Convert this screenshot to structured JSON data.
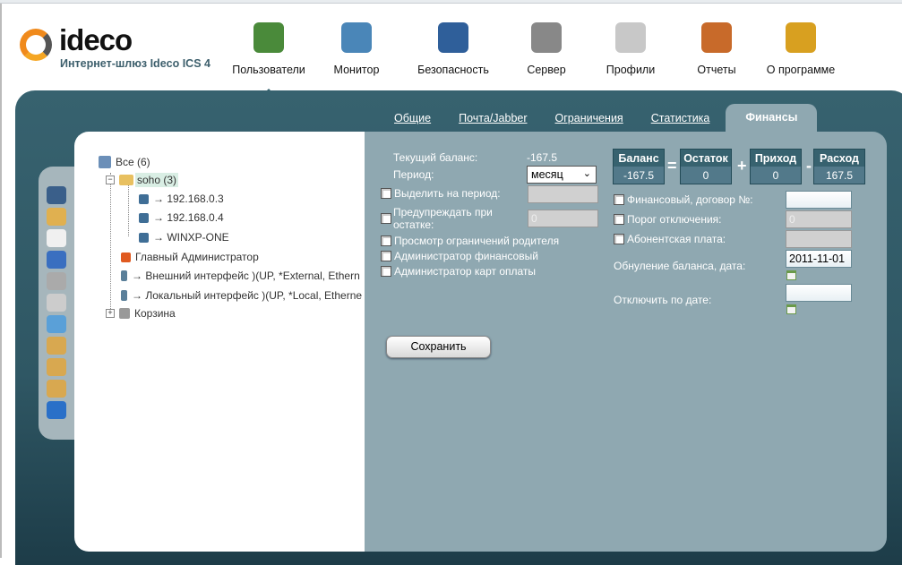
{
  "brand": {
    "name": "ideco",
    "subtitle": "Интернет-шлюз Ideco ICS 4"
  },
  "nav": [
    {
      "label": "Пользователи",
      "icon": "users-icon",
      "color": "#4a8a3a",
      "active": true
    },
    {
      "label": "Монитор",
      "icon": "monitor-icon",
      "color": "#4a86b8"
    },
    {
      "label": "Безопасность",
      "icon": "shield-icon",
      "color": "#2f5f9a"
    },
    {
      "label": "Сервер",
      "icon": "server-icon",
      "color": "#888888"
    },
    {
      "label": "Профили",
      "icon": "profile-icon",
      "color": "#c8c8c8"
    },
    {
      "label": "Отчеты",
      "icon": "report-icon",
      "color": "#c86a2a"
    },
    {
      "label": "О программе",
      "icon": "about-icon",
      "color": "#d8a020"
    }
  ],
  "tabs": [
    {
      "label": "Общие"
    },
    {
      "label": "Почта/Jabber"
    },
    {
      "label": "Ограничения"
    },
    {
      "label": "Статистика"
    },
    {
      "label": "Финансы",
      "active": true
    }
  ],
  "toolbar": [
    "add-user-icon",
    "add-folder-icon",
    "mail-icon",
    "info-icon",
    "server-icon",
    "search-icon",
    "monitor-icon",
    "clipboard-add-icon",
    "clipboard-list-icon",
    "clipboard-delete-icon",
    "refresh-icon"
  ],
  "tree": {
    "root": "Все (6)",
    "group": "soho (3)",
    "hosts": [
      "→ 192.168.0.3",
      "→ 192.168.0.4",
      "→ WINXP-ONE"
    ],
    "admin": "Главный Администратор",
    "ext": "→ Внешний интерфейс )(UP, *External, Ethern",
    "loc": "→ Локальный интерфейс )(UP, *Local, Etherne",
    "trash": "Корзина"
  },
  "form": {
    "balance_label": "Текущий баланс:",
    "balance_value": "-167.5",
    "period_label": "Период:",
    "period_value": "месяц",
    "allot_label": "Выделить на период:",
    "warn_label1": "Предупреждать при",
    "warn_label2": "остатке:",
    "warn_value": "0",
    "parent_label": "Просмотр ограничений родителя",
    "fin_admin_label": "Администратор финансовый",
    "card_admin_label": "Администратор карт оплаты",
    "contract_label": "Финансовый, договор №:",
    "threshold_label": "Порог отключения:",
    "threshold_value": "0",
    "fee_label": "Абонентская плата:",
    "reset_label": "Обнуление баланса, дата:",
    "reset_value": "2011-11-01",
    "disable_label": "Отключить по дате:",
    "save": "Сохранить"
  },
  "summary": {
    "balance": {
      "h": "Баланс",
      "v": "-167.5"
    },
    "rest": {
      "h": "Остаток",
      "v": "0"
    },
    "income": {
      "h": "Приход",
      "v": "0"
    },
    "expense": {
      "h": "Расход",
      "v": "167.5"
    },
    "eq": "=",
    "plus": "+",
    "minus": "-"
  }
}
